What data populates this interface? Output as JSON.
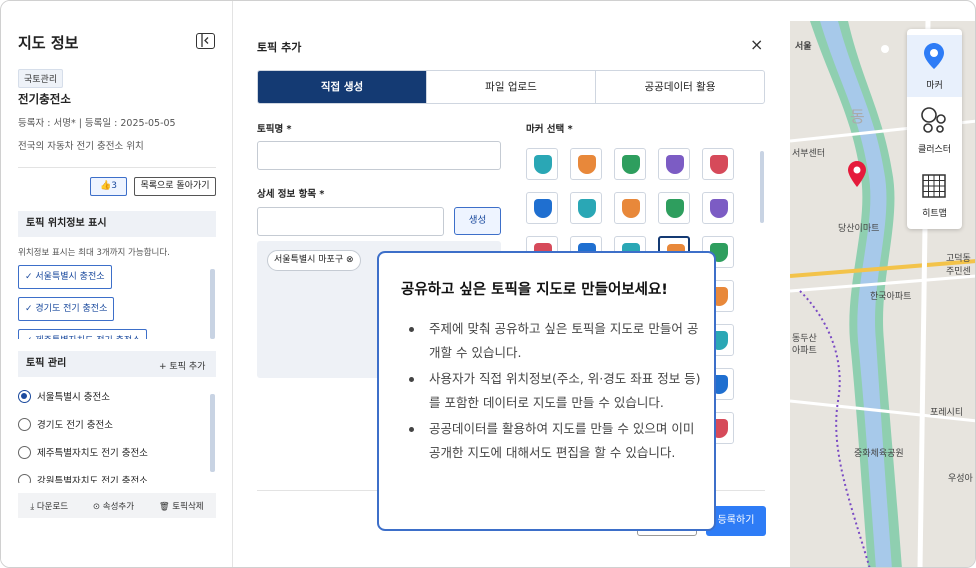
{
  "left": {
    "title": "지도 정보",
    "category_tag": "국토관리",
    "subject": "전기충전소",
    "meta": "등록자 : 서명*  |  등록일 : 2025-05-05",
    "description": "전국의 자동차 전기 충전소 위치",
    "like_count": "👍3",
    "back_button": "목록으로 돌아가기",
    "location_section": {
      "title": "토픽 위치정보 표시",
      "hint": "위치정보 표시는 최대 3개까지 가능합니다.",
      "chips": [
        "✓ 서울특별시 충전소",
        "✓ 경기도 전기 충전소",
        "✓ 제주특별자치도 전기 충전소"
      ]
    },
    "topic_section": {
      "title": "토픽 관리",
      "add_label": "+ 토픽 추가",
      "items": [
        {
          "label": "서울특별시 충전소",
          "selected": true
        },
        {
          "label": "경기도 전기 충전소",
          "selected": false
        },
        {
          "label": "제주특별자치도 전기 충전소",
          "selected": false
        },
        {
          "label": "강원특별자치도 전기 충전소",
          "selected": false
        }
      ]
    },
    "bottom_actions": [
      "⤓ 다운로드",
      "⊙ 속성추가",
      "🗑 토픽삭제"
    ]
  },
  "modal": {
    "title": "토픽 추가",
    "close_icon": "×",
    "tabs": [
      {
        "label": "직접 생성",
        "active": true
      },
      {
        "label": "파일 업로드",
        "active": false
      },
      {
        "label": "공공데이터 활용",
        "active": false
      }
    ],
    "topic_name_label": "토픽명 *",
    "detail_label": "상세 정보 항목 *",
    "generate_button": "생성",
    "detail_tag": "서울특별시 마포구 ⊗",
    "marker_label": "마커 선택 *",
    "register_button": "등록하기",
    "marker_colors": [
      "#2aa7b5",
      "#e8883a",
      "#2e9e5e",
      "#7c5cc4",
      "#d64a5a",
      "#1f6fd0"
    ]
  },
  "tools": [
    {
      "label": "마커",
      "icon": "marker-pin-icon",
      "active": true
    },
    {
      "label": "클러스터",
      "icon": "cluster-icon",
      "active": false
    },
    {
      "label": "히트맵",
      "icon": "heatmap-grid-icon",
      "active": false
    }
  ],
  "map_labels": [
    "서울",
    "동",
    "서부센터",
    "당산이마트",
    "한국아파트",
    "동두산",
    "아파트",
    "포레시티",
    "중화체육공원",
    "우성아",
    "고덕동",
    "주민센"
  ],
  "popover": {
    "title": "공유하고 싶은 토픽을 지도로 만들어보세요!",
    "bullets": [
      "주제에 맞춰 공유하고 싶은 토픽을 지도로 만들어 공개할 수 있습니다.",
      "사용자가 직접 위치정보(주소, 위·경도 좌표 정보 등)를 포함한 데이터로 지도를 만들 수 있습니다.",
      "공공데이터를 활용하여 지도를 만들 수 있으며 이미 공개한 지도에 대해서도 편집을 할 수 있습니다."
    ]
  }
}
